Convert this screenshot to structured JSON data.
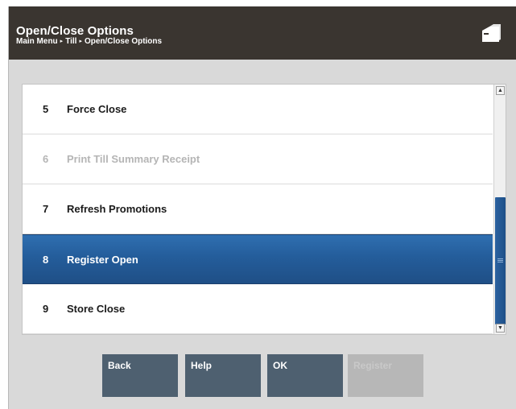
{
  "header": {
    "title": "Open/Close Options",
    "breadcrumb": [
      "Main Menu",
      "Till",
      "Open/Close Options"
    ],
    "breadcrumb_separator": "▸",
    "icon": "register-drawer-icon"
  },
  "list": {
    "items": [
      {
        "number": "5",
        "label": "Force Close",
        "state": "enabled"
      },
      {
        "number": "6",
        "label": "Print Till Summary Receipt",
        "state": "disabled"
      },
      {
        "number": "7",
        "label": "Refresh Promotions",
        "state": "enabled"
      },
      {
        "number": "8",
        "label": "Register Open",
        "state": "selected"
      },
      {
        "number": "9",
        "label": "Store Close",
        "state": "enabled"
      }
    ],
    "scroll_up_glyph": "▲",
    "scroll_down_glyph": "▼",
    "selection_color": "#245d9b"
  },
  "buttons": {
    "back": "Back",
    "help": "Help",
    "ok": "OK",
    "register": "Register"
  },
  "colors": {
    "header_bg": "#3a3530",
    "button_bg": "#4e6070",
    "button_disabled_bg": "#b7b7b7"
  }
}
